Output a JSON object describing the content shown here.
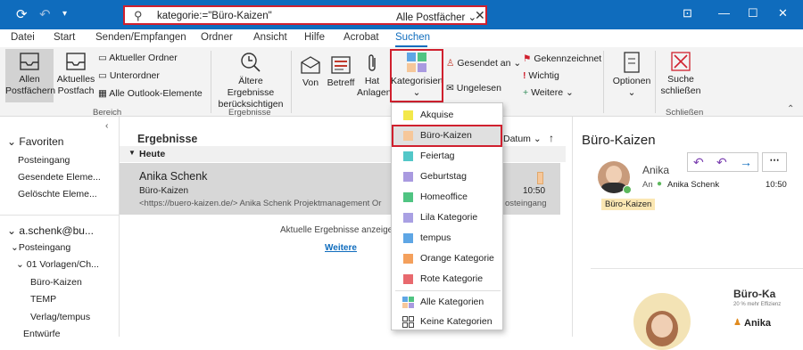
{
  "titlebar": {
    "sync_icon": "sync-icon",
    "undo_icon": "undo-icon",
    "qat_dropdown": "▾",
    "search_query": "kategorie:=\"Büro-Kaizen\"",
    "search_scope": "Alle Postfächer ⌄",
    "accent": "#0f6cbd",
    "highlight": "#d0202e"
  },
  "tabs": [
    "Datei",
    "Start",
    "Senden/Empfangen",
    "Ordner",
    "Ansicht",
    "Hilfe",
    "Acrobat",
    "Suchen"
  ],
  "ribbon": {
    "bereich": {
      "all_mailboxes": [
        "Allen",
        "Postfächern"
      ],
      "current_mailbox": [
        "Aktuelles",
        "Postfach"
      ],
      "current_folder": "Aktueller Ordner",
      "subfolders": "Unterordner",
      "all_outlook": "Alle Outlook-Elemente",
      "label": "Bereich"
    },
    "ergebnisse": {
      "older": [
        "Ältere Ergebnisse",
        "berücksichtigen"
      ],
      "label": "Ergebnisse"
    },
    "verfeinern": {
      "from": "Von",
      "subject": "Betreff",
      "attachments": [
        "Hat",
        "Anlagen"
      ],
      "categorized": "Kategorisiert",
      "categorized_caret": "⌄",
      "sent_to": "Gesendet an ⌄",
      "unread": "Ungelesen",
      "flagged": "Gekennzeichnet",
      "important": "Wichtig",
      "more": "Weitere ⌄"
    },
    "options": {
      "label": "Optionen",
      "caret": "⌄"
    },
    "close": {
      "search_close": [
        "Suche",
        "schließen"
      ],
      "label": "Schließen"
    }
  },
  "left_pane": {
    "favorites": "Favoriten",
    "fav_items": [
      "Posteingang",
      "Gesendete Eleme...",
      "Gelöschte Eleme..."
    ],
    "account": "a.schenk@bu...",
    "inbox": "Posteingang",
    "folder": "01 Vorlagen/Ch...",
    "sub_items": [
      "Büro-Kaizen",
      "TEMP",
      "Verlag/tempus"
    ],
    "drafts": "Entwürfe"
  },
  "middle": {
    "header": "Ergebnisse",
    "sort": "Datum ⌄",
    "sort_arrow": "↑",
    "group": "Heute",
    "mail": {
      "sender": "Anika Schenk",
      "subject": "Büro-Kaizen",
      "preview": "<https://buero-kaizen.de/>   Anika Schenk  Projektmanagement Or",
      "folder_tail": "osteingang",
      "time": "10:50"
    },
    "current_results": "Aktuelle Ergebnisse anzeigen",
    "more": "Weitere"
  },
  "reading": {
    "title": "Büro-Kaizen",
    "from": "Anika",
    "to_label": "An",
    "to_name": "Anika Schenk",
    "time": "10:50",
    "category": "Büro-Kaizen",
    "sig_brand": "Büro-Ka",
    "sig_tag": "20 % mehr Effizienz",
    "sig_name": "Anika"
  },
  "categories": [
    {
      "label": "Akquise",
      "color": "#f3e84b"
    },
    {
      "label": "Büro-Kaizen",
      "color": "#f6c79a"
    },
    {
      "label": "Feiertag",
      "color": "#52c7c8"
    },
    {
      "label": "Geburtstag",
      "color": "#a99ae0"
    },
    {
      "label": "Homeoffice",
      "color": "#50c482"
    },
    {
      "label": "Lila Kategorie",
      "color": "#a9a0e3"
    },
    {
      "label": "tempus",
      "color": "#5ea6e5"
    },
    {
      "label": "Orange Kategorie",
      "color": "#f4a05c"
    },
    {
      "label": "Rote Kategorie",
      "color": "#e8696e"
    }
  ],
  "dropdown_footer": {
    "all": "Alle Kategorien",
    "none": "Keine Kategorien"
  }
}
